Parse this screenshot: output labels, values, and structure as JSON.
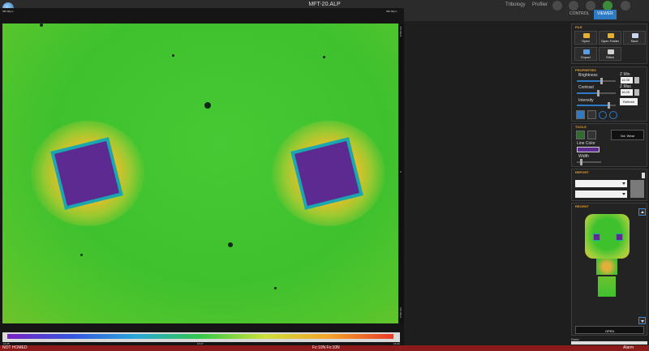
{
  "window": {
    "title": "MFT-20.ALP",
    "modes": [
      "Tribology",
      "Profiler"
    ],
    "view_tabs": [
      "CONTROL",
      "VIEWER"
    ],
    "active_view_tab": "VIEWER"
  },
  "viewer": {
    "top_left_scale": "985.68μm",
    "top_right_scale": "985.68μm",
    "right_top_scale": "723.42μm",
    "right_mid_scale": "0",
    "right_bottom_scale": "723.42μm",
    "colorbar_min": "14.05",
    "colorbar_mid": "15.07",
    "colorbar_max": "16.09",
    "colormap": [
      "#7a22c2",
      "#3556e0",
      "#2aa6d8",
      "#33c94a",
      "#cde03a",
      "#f3a42a",
      "#e83a2a"
    ]
  },
  "file_panel": {
    "title": "FILE",
    "buttons": [
      "Open",
      "Open Folder",
      "Save",
      "Export",
      "Stitch"
    ]
  },
  "properties_panel": {
    "title": "PROPERTIES",
    "brightness_label": "Brightness",
    "brightness_level": 0.62,
    "contrast_label": "Contrast",
    "contrast_level": 0.55,
    "intensity_label": "Intensity",
    "intensity_level": 0.82,
    "zmin_label": "Z Min",
    "zmin_value": "14.05",
    "zmax_label": "Z Max",
    "zmax_value": "16.09",
    "refresh_label": "Refresh"
  },
  "tools_panel": {
    "title": "TOOLS",
    "vol_wear_label": "Vol. Wear",
    "line_color_label": "Line Color",
    "line_color": "#5c2a91",
    "width_label": "Width"
  },
  "report_panel": {
    "title": "REPORT"
  },
  "recent_panel": {
    "title": "RECENT",
    "open_label": "OPEN"
  },
  "status": {
    "left": "NOT HOMED",
    "center": "Fz:10N Fx:10N",
    "right": "Alarm",
    "done": "Done."
  }
}
